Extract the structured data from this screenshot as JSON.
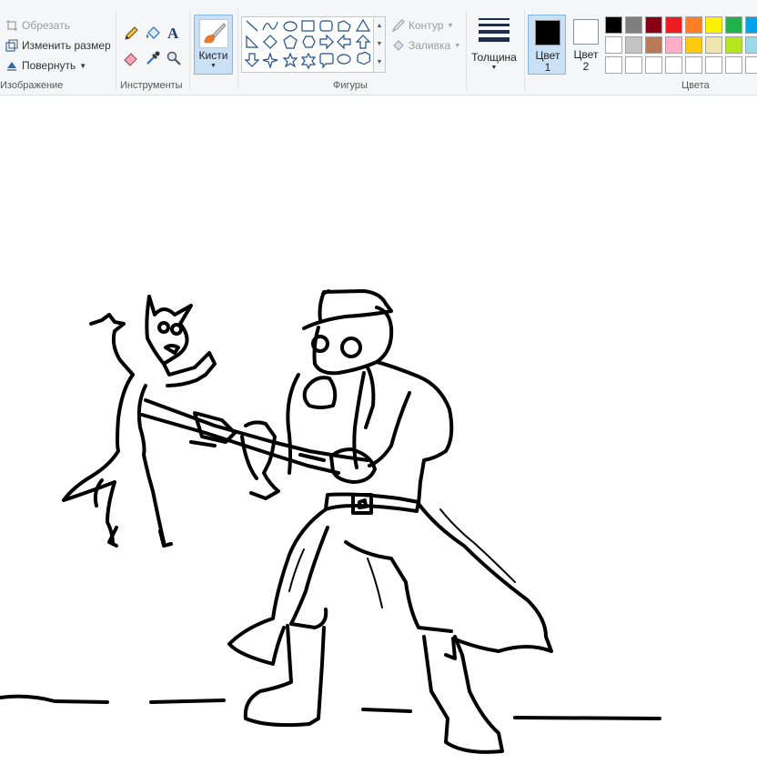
{
  "ribbon": {
    "image_group": {
      "label": "Изображение",
      "crop_label": "Обрезать",
      "resize_label": "Изменить размер",
      "rotate_label": "Повернуть"
    },
    "tools_group": {
      "label": "Инструменты"
    },
    "brushes": {
      "label": "Кисти"
    },
    "shapes_group": {
      "label": "Фигуры",
      "outline_label": "Контур",
      "fill_label": "Заливка"
    },
    "thickness": {
      "label": "Толщина"
    },
    "color1": {
      "label_line1": "Цвет",
      "label_line2": "1",
      "value": "#000000"
    },
    "color2": {
      "label_line1": "Цвет",
      "label_line2": "2",
      "value": "#ffffff"
    },
    "colors_group": {
      "label": "Цвета",
      "row1": [
        "#000000",
        "#7f7f7f",
        "#880015",
        "#ed1c24",
        "#ff7f27",
        "#fff200",
        "#22b14c",
        "#00a2e8"
      ],
      "row2": [
        "#ffffff",
        "#c3c3c3",
        "#b97a57",
        "#ffaec9",
        "#ffc90e",
        "#efe4b0",
        "#b5e61d",
        "#99d9ea"
      ],
      "row3": [
        "#ffffff",
        "#ffffff",
        "#ffffff",
        "#ffffff",
        "#ffffff",
        "#ffffff",
        "#ffffff",
        "#ffffff"
      ]
    }
  },
  "canvas": {
    "stroke_color": "#000000",
    "background": "#ffffff"
  }
}
